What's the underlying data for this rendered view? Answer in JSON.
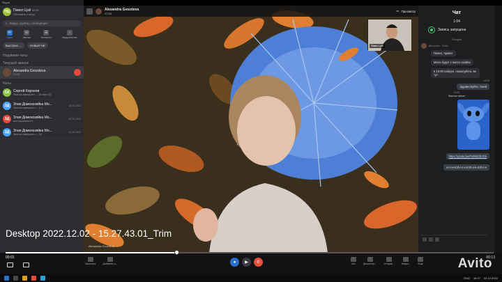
{
  "window": {
    "app_title": "Skype"
  },
  "sidebar": {
    "profile": {
      "initials": "ПЦ",
      "name": "Павел Цой",
      "balance": "30,00",
      "status": "Обновить статус"
    },
    "search_placeholder": "Люди, группы, сообщения",
    "nav": [
      {
        "label": "Чаты",
        "icon": "chat-icon"
      },
      {
        "label": "Звонки",
        "icon": "phone-icon"
      },
      {
        "label": "Контакты",
        "icon": "contacts-icon"
      },
      {
        "label": "Уведомления",
        "icon": "bell-icon"
      }
    ],
    "quick_btn": "Быстрое ...",
    "new_chat_btn": "Новый чат",
    "recent_header": "Недавние чаты",
    "current_call_header": "Текущий звонок",
    "current_call": {
      "name": "Alexandra Gvozdeva",
      "duration": "27:42"
    },
    "chats_header": "Чаты",
    "chats": [
      {
        "initials": "СК",
        "color": "#8bc34a",
        "name": "Сергей Корнеев",
        "sub": "Звонок завершен — 36 мин 33",
        "date": ""
      },
      {
        "initials": "ЗД",
        "color": "#4aa3ff",
        "name": "Злая Домохозяйка Мо...",
        "sub": "Звонок завершен — 1 ч",
        "date": "20.11.2022"
      },
      {
        "initials": "ЗД",
        "color": "#e64b3c",
        "name": "Злая Домохозяйка Мо...",
        "sub": "все нормально?",
        "date": "22.10.2022"
      },
      {
        "initials": "ЗД",
        "color": "#4aa3ff",
        "name": "Злая Домохозяйка Мо...",
        "sub": "Звонок завершен — 31",
        "date": "14.10.2022"
      }
    ]
  },
  "call": {
    "caller": "Alexandra Gvozdeva",
    "duration": "27:42",
    "screen_btn": "Просмотр",
    "self_label": "Павел Цой",
    "video_label": "Alexandra Gvozdeva"
  },
  "chat_panel": {
    "title": "Чат",
    "rec_time": "1:04",
    "rec_text": "Запись запущена",
    "divider_today": "Сегодня",
    "sender": "Alexandra",
    "sender_time": "14:46",
    "messages_in": [
      "Павел, привет",
      "Мила будет с моего скайпа",
      "в 15:00 наберн, пожалуйста, ве тут"
    ],
    "out_time": "14:59",
    "msg_out": "Здравствуйте, Окей",
    "call_time": "15:00",
    "call_started": "Звонок начат",
    "link": "https://youtu.be/PvtM0ZEzGk",
    "last_out": "s-t-t-s-Kzh-t-t-s-Kzh-s-k-Kzh-t-s"
  },
  "player": {
    "current": "00:01",
    "total": "00:13",
    "progress": 0.35,
    "caption": "Desktop 2022.12.02 - 15.27.43.01_Trim",
    "sub_left": [
      "Записать",
      "Добавить у..."
    ],
    "sub_right": [
      "Чат",
      "Демонстр...",
      "Отправ...",
      "Микро...",
      "Еще"
    ]
  },
  "taskbar": {
    "lang": "ENG",
    "time": "15:27",
    "date": "02.12.2022"
  },
  "watermark": "Avito",
  "colors": {
    "accent": "#2a6fc9",
    "end_call": "#e64b3c",
    "recording": "#3ccf6b"
  }
}
